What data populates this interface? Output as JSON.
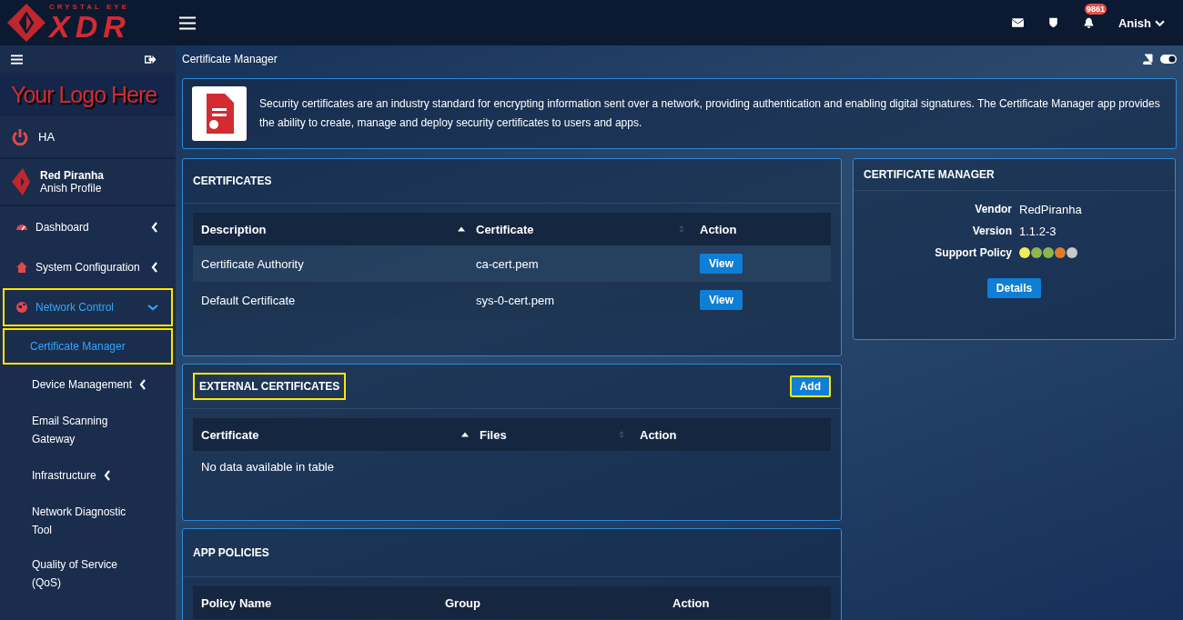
{
  "brand": {
    "tagline": "CRYSTAL EYE",
    "name": "XDR"
  },
  "topbar": {
    "notifications": "9861",
    "user": "Anish"
  },
  "sidebar": {
    "logo_text": "Your Logo Here",
    "ha": "HA",
    "profile": {
      "org": "Red Piranha",
      "name": "Anish Profile"
    },
    "items": [
      {
        "label": "Dashboard",
        "expanded": false,
        "highlighted": false,
        "selected": false
      },
      {
        "label": "System Configuration",
        "expanded": false,
        "highlighted": false,
        "selected": false
      },
      {
        "label": "Network Control",
        "expanded": true,
        "highlighted": true,
        "selected": true,
        "children": [
          {
            "label": "Certificate Manager",
            "expandable": false,
            "highlighted": true,
            "selected": true
          },
          {
            "label": "Device Management",
            "expandable": true,
            "highlighted": false,
            "selected": false
          },
          {
            "label": "Email Scanning Gateway",
            "expandable": false,
            "highlighted": false,
            "selected": false
          },
          {
            "label": "Infrastructure",
            "expandable": true,
            "highlighted": false,
            "selected": false
          },
          {
            "label": "Network Diagnostic Tool",
            "expandable": false,
            "highlighted": false,
            "selected": false
          },
          {
            "label": "Quality of Service (QoS)",
            "expandable": false,
            "highlighted": false,
            "selected": false
          }
        ]
      }
    ]
  },
  "breadcrumb": "Certificate Manager",
  "intro": "Security certificates are an industry standard for encrypting information sent over a network, providing authentication and enabling digital signatures. The Certificate Manager app provides the ability to create, manage and deploy security certificates to users and apps.",
  "certificates": {
    "title": "CERTIFICATES",
    "columns": [
      "Description",
      "Certificate",
      "Action"
    ],
    "rows": [
      {
        "description": "Certificate Authority",
        "certificate": "ca-cert.pem",
        "action": "View"
      },
      {
        "description": "Default Certificate",
        "certificate": "sys-0-cert.pem",
        "action": "View"
      }
    ]
  },
  "external_certificates": {
    "title": "EXTERNAL CERTIFICATES",
    "highlighted": true,
    "add_button": "Add",
    "add_highlighted": true,
    "columns": [
      "Certificate",
      "Files",
      "Action"
    ],
    "empty_text": "No data available in table"
  },
  "app_policies": {
    "title": "APP POLICIES",
    "columns": [
      "Policy Name",
      "Group",
      "Action"
    ]
  },
  "info": {
    "title": "CERTIFICATE MANAGER",
    "fields": [
      {
        "label": "Vendor",
        "value": "RedPiranha"
      },
      {
        "label": "Version",
        "value": "1.1.2-3"
      }
    ],
    "support_label": "Support Policy",
    "support_dots": [
      {
        "color": "#f2ee5a"
      },
      {
        "color": "#8fb54e"
      },
      {
        "color": "#8fb54e"
      },
      {
        "color": "#e07b2c"
      },
      {
        "color": "#c8c8c8"
      }
    ],
    "button": "Details"
  }
}
